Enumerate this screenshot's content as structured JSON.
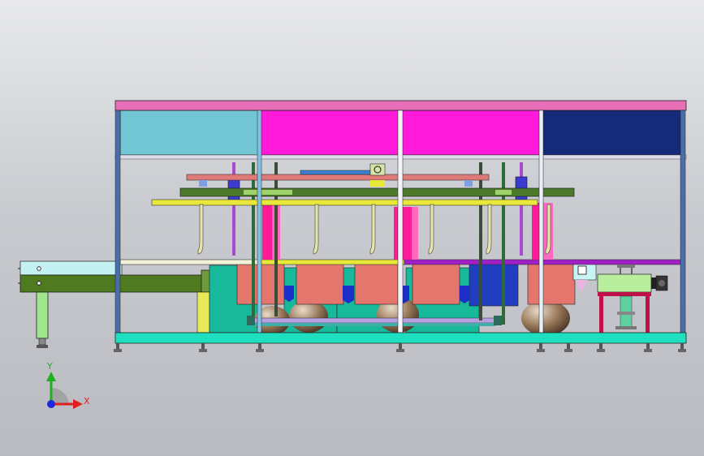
{
  "triad": {
    "x_label": "X",
    "y_label": "Y",
    "x_color": "#e02020",
    "y_color": "#20b020",
    "z_color": "#1a2ad8"
  },
  "colors": {
    "frame_top": "#e66fb8",
    "frame_post": "#4a6fa8",
    "panel_cyan": "#72c6d4",
    "panel_magenta": "#ff19d8",
    "panel_navy": "#152a78",
    "base_rail": "#1de0c0",
    "conveyor": "#4f7a1f",
    "teal_block": "#18b89a",
    "salmon": "#e5766e",
    "blue_block": "#1f3fc0",
    "yellow_bar": "#e8e838",
    "olive_beam": "#4d7a2a",
    "pink_cylinder": "#ff1a9a",
    "bronze": "#9a7a5a",
    "red_stand": "#c0104a",
    "light_green": "#a6e890"
  }
}
